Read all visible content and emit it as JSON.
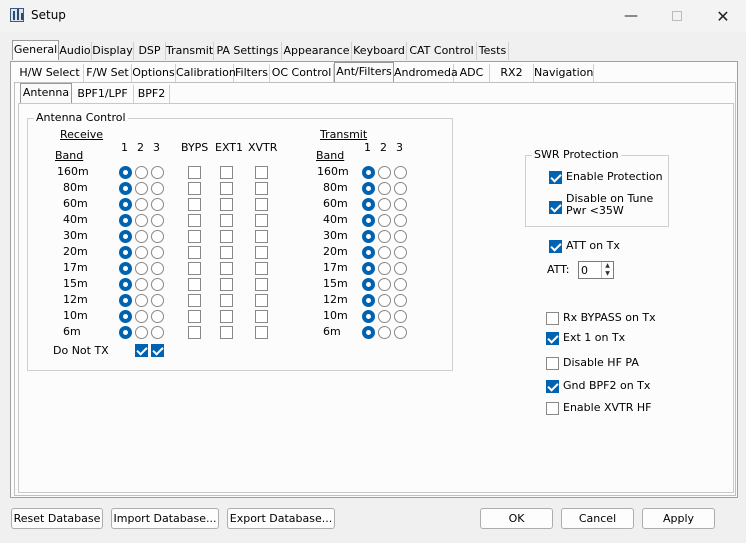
{
  "window": {
    "title": "Setup",
    "minimize_icon": "minimize-icon",
    "maximize_icon": "maximize-icon",
    "close_icon": "close-icon"
  },
  "main_tabs": [
    "General",
    "Audio",
    "Display",
    "DSP",
    "Transmit",
    "PA Settings",
    "Appearance",
    "Keyboard",
    "CAT Control",
    "Tests"
  ],
  "general_tabs": [
    "H/W Select",
    "F/W Set",
    "Options",
    "Calibration",
    "Filters",
    "OC Control",
    "Ant/Filters",
    "Andromeda",
    "ADC",
    "RX2",
    "Navigation"
  ],
  "ant_tabs": [
    "Antenna",
    "BPF1/LPF",
    "BPF2"
  ],
  "antenna_control": {
    "title": "Antenna Control",
    "receive_label": "Receive",
    "transmit_label": "Transmit",
    "band_label": "Band",
    "col1": "1",
    "col2": "2",
    "col3": "3",
    "byps": "BYPS",
    "ext1": "EXT1",
    "xvtr": "XVTR",
    "bands": [
      "160m",
      "80m",
      "60m",
      "40m",
      "30m",
      "20m",
      "17m",
      "15m",
      "12m",
      "10m",
      "6m"
    ],
    "do_not_tx": "Do Not TX"
  },
  "swr": {
    "title": "SWR Protection",
    "enable_protection": "Enable Protection",
    "disable_tune_line1": "Disable on Tune",
    "disable_tune_line2": "Pwr <35W"
  },
  "att_on_tx": "ATT on Tx",
  "att_label": "ATT:",
  "att_value": "0",
  "options": [
    "Rx BYPASS on Tx",
    "Ext 1 on Tx",
    "Disable HF PA",
    "Gnd BPF2 on Tx",
    "Enable XVTR HF"
  ],
  "buttons": {
    "reset": "Reset Database",
    "import": "Import Database...",
    "export": "Export Database...",
    "ok": "OK",
    "cancel": "Cancel",
    "apply": "Apply"
  }
}
